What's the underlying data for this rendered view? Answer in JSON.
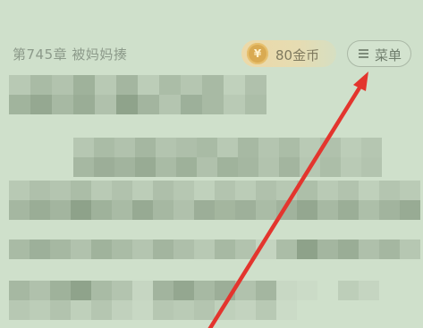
{
  "header": {
    "chapter_title": "第745章 被妈妈揍",
    "coin": {
      "icon": "coin-icon",
      "icon_glyph": "¥",
      "label": "80金币"
    },
    "menu": {
      "icon": "hamburger-menu-icon",
      "label": "菜单"
    }
  },
  "colors": {
    "background": "#cfe0cb",
    "annotation_arrow": "#e3352e",
    "coin": "#d9aa52"
  }
}
